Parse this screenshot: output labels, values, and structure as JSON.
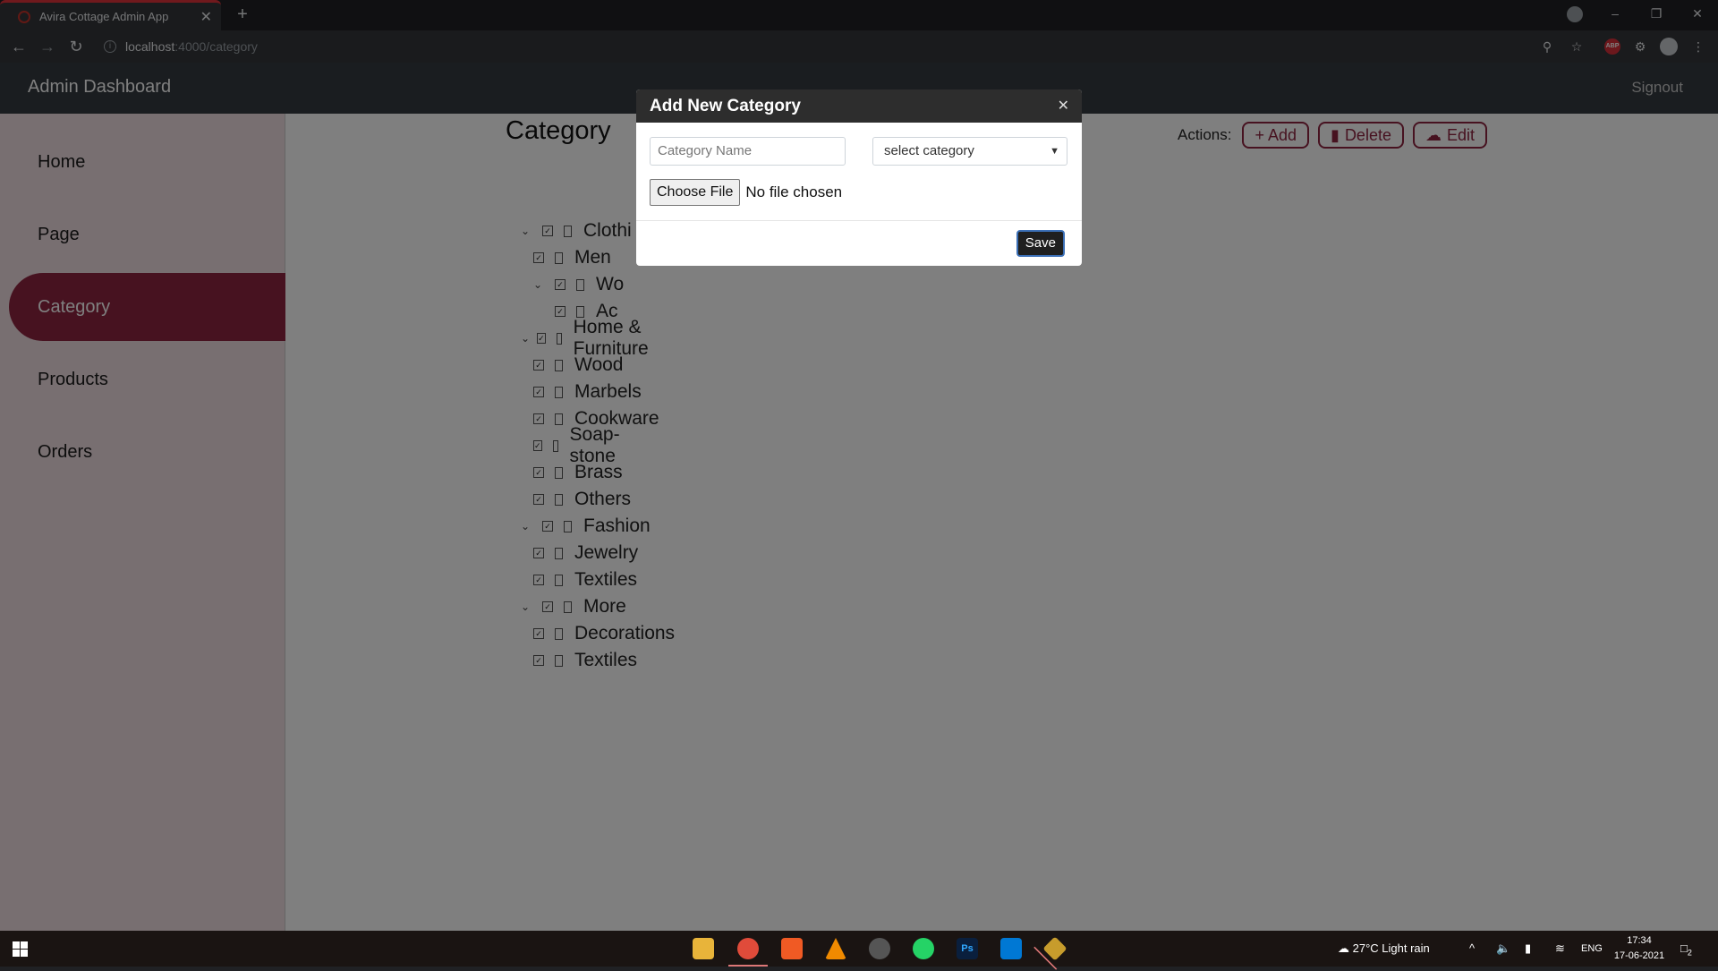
{
  "browser": {
    "tab_title": "Avira Cottage Admin App",
    "tab_close": "✕",
    "new_tab": "+",
    "url_host": "localhost",
    "url_path": ":4000/category",
    "info_icon": "i"
  },
  "navbar": {
    "brand": "Admin Dashboard",
    "signout": "Signout"
  },
  "sidebar": {
    "items": [
      {
        "label": "Home"
      },
      {
        "label": "Page"
      },
      {
        "label": "Category"
      },
      {
        "label": "Products"
      },
      {
        "label": "Orders"
      }
    ],
    "active": "Category"
  },
  "main": {
    "title": "Category",
    "actions_label": "Actions:",
    "add_label": "+ Add",
    "delete_label": "Delete",
    "edit_label": "Edit"
  },
  "tree": [
    {
      "label": "Clothi",
      "level": 0,
      "expanded": true
    },
    {
      "label": "Men",
      "level": 1,
      "expanded": null
    },
    {
      "label": "Wo",
      "level": 1,
      "expanded": true
    },
    {
      "label": "Ac",
      "level": 2,
      "expanded": null
    },
    {
      "label": "Home & Furniture",
      "level": 0,
      "expanded": true
    },
    {
      "label": "Wood",
      "level": 1,
      "expanded": null
    },
    {
      "label": "Marbels",
      "level": 1,
      "expanded": null
    },
    {
      "label": "Cookware",
      "level": 1,
      "expanded": null
    },
    {
      "label": "Soap-stone",
      "level": 1,
      "expanded": null
    },
    {
      "label": "Brass",
      "level": 1,
      "expanded": null
    },
    {
      "label": "Others",
      "level": 1,
      "expanded": null
    },
    {
      "label": "Fashion",
      "level": 0,
      "expanded": true
    },
    {
      "label": "Jewelry",
      "level": 1,
      "expanded": null
    },
    {
      "label": "Textiles",
      "level": 1,
      "expanded": null
    },
    {
      "label": "More",
      "level": 0,
      "expanded": true
    },
    {
      "label": "Decorations",
      "level": 1,
      "expanded": null
    },
    {
      "label": "Textiles",
      "level": 1,
      "expanded": null
    }
  ],
  "modal": {
    "title": "Add New Category",
    "close_icon": "✕",
    "name_placeholder": "Category Name",
    "select_value": "select category",
    "file_button": "Choose File",
    "file_status": "No file chosen",
    "save_label": "Save"
  },
  "taskbar": {
    "weather": "27°C  Light rain",
    "lang": "ENG",
    "time": "17:34",
    "date": "17-06-2021",
    "notifications": "2"
  },
  "colors": {
    "accent": "#8e2440",
    "sidebar_bg": "#f0dfe3",
    "navbar_bg": "#343a40",
    "modal_header": "#2d2d2d"
  }
}
